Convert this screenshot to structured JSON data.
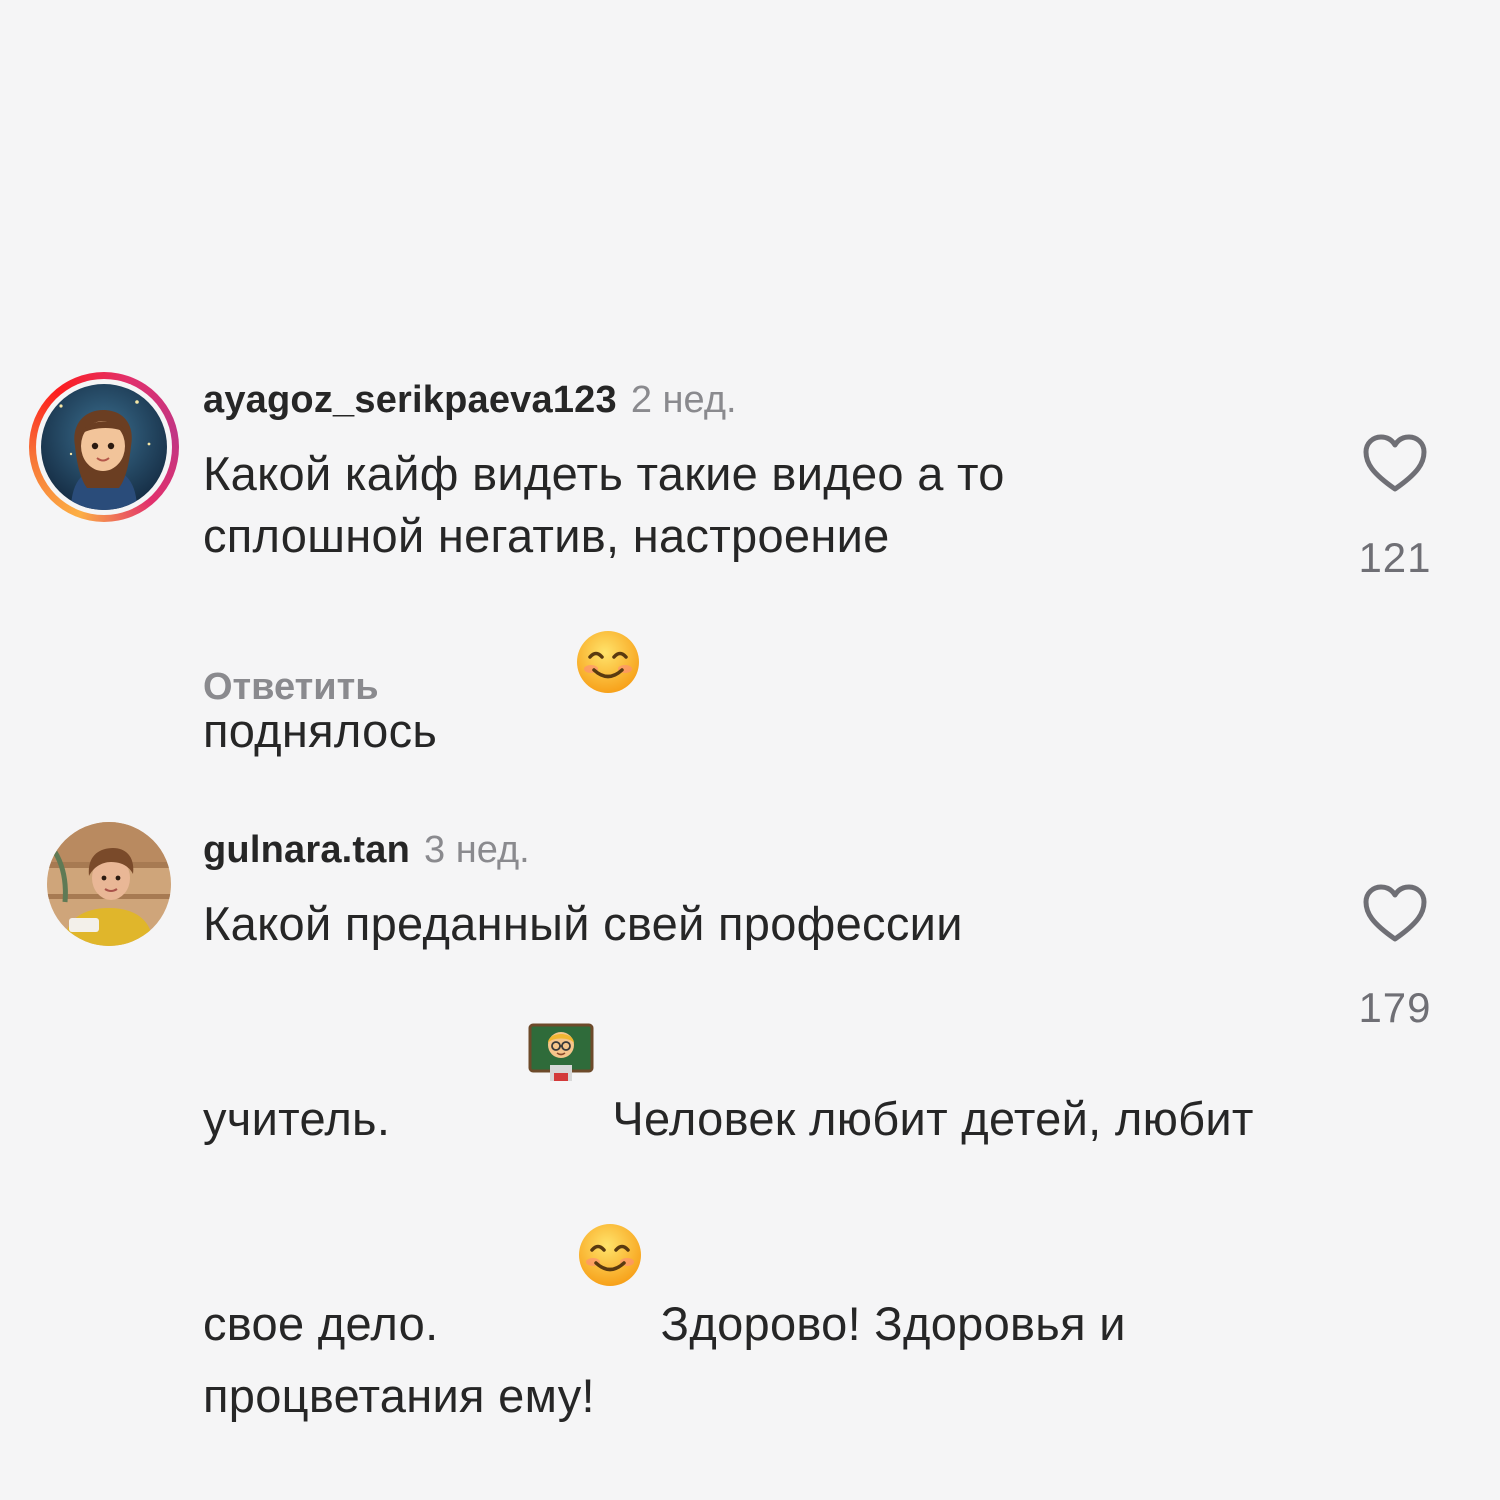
{
  "comments": [
    {
      "username": "ayagoz_serikpaeva123",
      "time": "2 нед.",
      "has_story_ring": true,
      "text_lines": [
        "Какой кайф видеть такие видео а то",
        "сплошной негатив, настроение",
        "поднялось"
      ],
      "emoji_after_last_line": "smiling-face-with-smiling-eyes",
      "reply_label": "Ответить",
      "likes": "121",
      "like_icon": "heart-outline-icon"
    },
    {
      "username": "gulnara.tan",
      "time": "3 нед.",
      "has_story_ring": false,
      "text_lines": [
        "Какой преданный свей профессии",
        "учитель.",
        "Человек любит детей, любит",
        "свое дело.",
        "Здорово! Здоровья и",
        "процветания ему!"
      ],
      "emojis": [
        "man-teacher",
        "smiling-face-with-smiling-eyes"
      ],
      "likes": "179",
      "like_icon": "heart-outline-icon"
    }
  ],
  "colors": {
    "background": "#f5f5f6",
    "text": "#262626",
    "secondary_text": "#8a8a8e",
    "story_ring": [
      "#fcaf45",
      "#e1306c",
      "#c13584"
    ]
  }
}
